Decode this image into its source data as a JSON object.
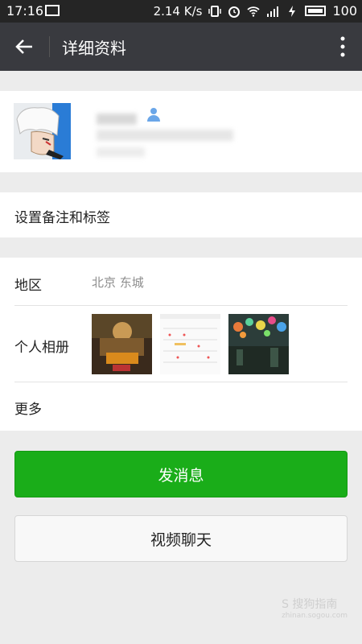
{
  "status_bar": {
    "time": "17:16",
    "net_speed": "2.14 K/s",
    "battery": "100"
  },
  "app_bar": {
    "title": "详细资料"
  },
  "rows": {
    "remark_tags": "设置备注和标签",
    "region_label": "地区",
    "region_value": "北京  东城",
    "album_label": "个人相册",
    "more_label": "更多"
  },
  "buttons": {
    "send_message": "发消息",
    "video_chat": "视频聊天"
  },
  "watermark": {
    "text": "S 搜狗指南",
    "sub": "zhinan.sogou.com"
  },
  "colors": {
    "app_bar": "#393a3f",
    "status_bar": "#252525",
    "primary_green": "#1aad19"
  }
}
